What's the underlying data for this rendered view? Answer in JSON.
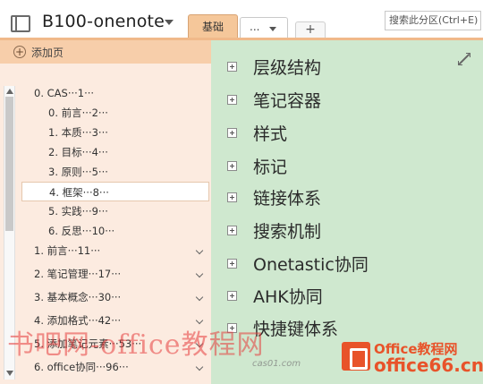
{
  "header": {
    "notebook_title": "B100-onenote",
    "tabs": [
      {
        "label": "基础",
        "active": true
      },
      {
        "label": "...",
        "active": false
      }
    ],
    "add_tab_label": "+",
    "search_placeholder": "搜索此分区(Ctrl+E)"
  },
  "pages_panel": {
    "add_page_label": "添加页",
    "pages": [
      {
        "label": "0. CAS···1···",
        "level": 0,
        "expandable": false
      },
      {
        "label": "0. 前言···2···",
        "level": 1,
        "expandable": false
      },
      {
        "label": "1. 本质···3···",
        "level": 1,
        "expandable": false
      },
      {
        "label": "2. 目标···4···",
        "level": 1,
        "expandable": false
      },
      {
        "label": "3. 原则···5···",
        "level": 1,
        "expandable": false
      },
      {
        "label": "4. 框架···8···",
        "level": 1,
        "expandable": false,
        "selected": true
      },
      {
        "label": "5. 实践···9···",
        "level": 1,
        "expandable": false
      },
      {
        "label": "6. 反思···10···",
        "level": 1,
        "expandable": false
      },
      {
        "label": "1. 前言···11···",
        "level": 0,
        "expandable": true
      },
      {
        "label": "2. 笔记管理···17···",
        "level": 0,
        "expandable": true
      },
      {
        "label": "3. 基本概念···30···",
        "level": 0,
        "expandable": true
      },
      {
        "label": "4. 添加格式···42···",
        "level": 0,
        "expandable": true
      },
      {
        "label": "5. 添加笔记元素···53···",
        "level": 0,
        "expandable": true
      },
      {
        "label": "6. office协同···96···",
        "level": 0,
        "expandable": true
      }
    ]
  },
  "content": {
    "outline": [
      "层级结构",
      "笔记容器",
      "样式",
      "标记",
      "链接体系",
      "搜索机制",
      "Onetastic协同",
      "AHK协同",
      "快捷键体系"
    ]
  },
  "watermark": {
    "text": "书吧网-office教程网",
    "small": "cas01.com",
    "brand": "Office教程网",
    "site": "office66.cn"
  },
  "colors": {
    "accent_orange": "#f5c79a",
    "panel_bg": "#fcebe0",
    "content_bg": "#cfe8cf",
    "watermark_red": "#e63c3c",
    "logo_orange": "#e8532a"
  }
}
